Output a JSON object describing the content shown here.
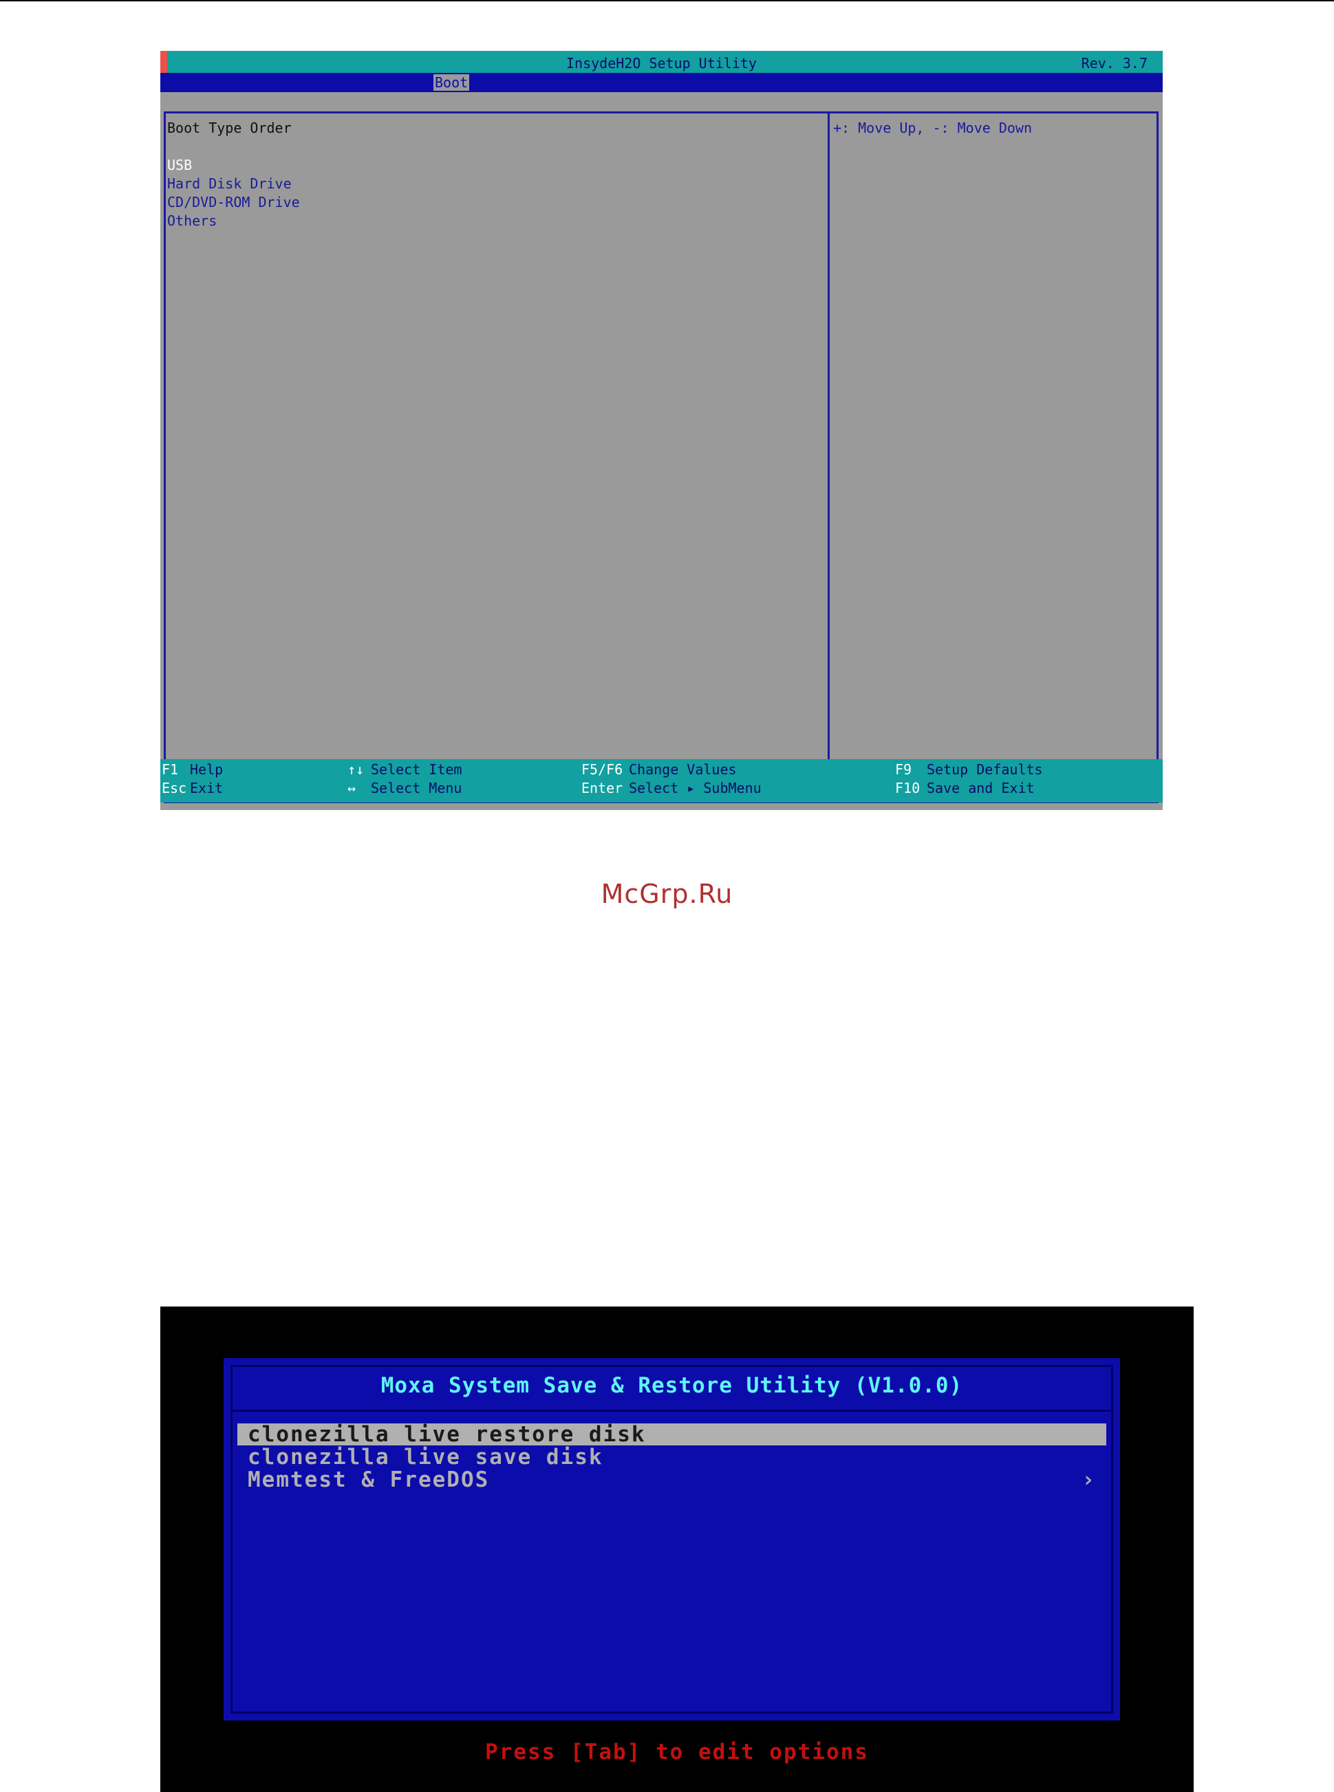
{
  "watermark": "McGrp.Ru",
  "bios": {
    "title": "InsydeH2O Setup Utility",
    "revision": "Rev. 3.7",
    "active_tab": "Boot",
    "section_heading": "Boot Type Order",
    "boot_order": [
      "USB",
      "Hard Disk Drive",
      "CD/DVD-ROM Drive",
      "Others"
    ],
    "help_text": "+: Move Up, -: Move Down",
    "footer": [
      {
        "key": "F1",
        "desc": "Help"
      },
      {
        "key": "Esc",
        "desc": "Exit"
      },
      {
        "key": "↑↓",
        "desc": "Select Item"
      },
      {
        "key": "↔",
        "desc": "Select Menu"
      },
      {
        "key": "F5/F6",
        "desc": "Change Values"
      },
      {
        "key": "Enter",
        "desc": "Select ▸ SubMenu"
      },
      {
        "key": "F9",
        "desc": "Setup Defaults"
      },
      {
        "key": "F10",
        "desc": "Save and Exit"
      }
    ],
    "colors": {
      "title_bar": "#12a0a0",
      "menu_bar": "#0c0ca8",
      "body": "#9a9a9a",
      "frame": "#1a1aa0"
    }
  },
  "bootmenu": {
    "title": "Moxa System Save & Restore Utility (V1.0.0)",
    "items": [
      {
        "label": "clonezilla live restore disk",
        "selected": true
      },
      {
        "label": "clonezilla live save disk",
        "selected": false
      },
      {
        "label": "Memtest & FreeDOS",
        "selected": false,
        "submenu_icon": "chevron-right-icon"
      }
    ],
    "hint": "Press [Tab] to edit options",
    "colors": {
      "background": "#0c0cab",
      "title": "#5ff4f4",
      "hint": "#c41010",
      "selected_bg": "#b0b0b0"
    }
  }
}
